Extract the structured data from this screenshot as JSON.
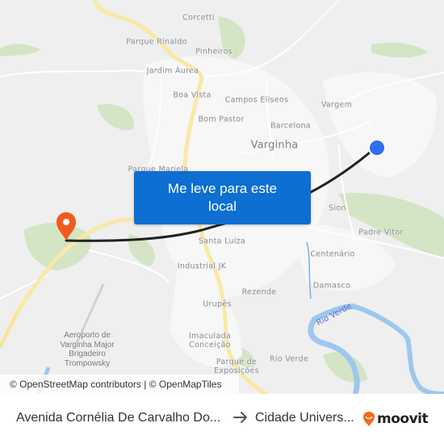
{
  "map": {
    "city_label": "Varginha",
    "place_labels": [
      {
        "name": "Corcetti",
        "type": "suburb"
      },
      {
        "name": "Parque Rinaldo",
        "type": "suburb"
      },
      {
        "name": "Pinheiros",
        "type": "suburb"
      },
      {
        "name": "Jardim Áurea",
        "type": "suburb"
      },
      {
        "name": "Boa Vista",
        "type": "suburb"
      },
      {
        "name": "Campos Elíseos",
        "type": "suburb"
      },
      {
        "name": "Vargem",
        "type": "suburb"
      },
      {
        "name": "Bom Pastor",
        "type": "suburb"
      },
      {
        "name": "Barcelona",
        "type": "suburb"
      },
      {
        "name": "Parque Mariela",
        "type": "suburb"
      },
      {
        "name": "Sion",
        "type": "suburb"
      },
      {
        "name": "Padre Vitor",
        "type": "suburb"
      },
      {
        "name": "Santa Luíza",
        "type": "suburb"
      },
      {
        "name": "Centenário",
        "type": "suburb"
      },
      {
        "name": "Industrial JK",
        "type": "suburb"
      },
      {
        "name": "Rezende",
        "type": "suburb"
      },
      {
        "name": "Damasco",
        "type": "suburb"
      },
      {
        "name": "Urupês",
        "type": "suburb"
      },
      {
        "name": "Imaculada\nConceição",
        "type": "suburb"
      },
      {
        "name": "Rio Verde",
        "type": "suburb"
      },
      {
        "name": "Parque de\nExposições",
        "type": "suburb"
      }
    ],
    "poi_label": "Aeroporto de\nVarginha Major\nBrigadeiro\nTrompowsky",
    "river_label": "Rio Verde",
    "origin_marker": {
      "icon": "location-pin-icon",
      "color": "#f25a1d"
    },
    "destination_marker": {
      "icon": "blue-dot-icon",
      "color": "#2f6ff0"
    },
    "route_color": "#222222",
    "cta_label": "Me leve para este local",
    "cta_color": "#0c6fd1",
    "attribution": "© OpenStreetMap contributors | © OpenMapTiles"
  },
  "footer": {
    "origin": "Avenida Cornélia De Carvalho Do...",
    "arrow_icon": "arrow-right-icon",
    "destination": "Cidade Univers...",
    "brand": "moovit",
    "brand_color": "#f26b1d"
  }
}
